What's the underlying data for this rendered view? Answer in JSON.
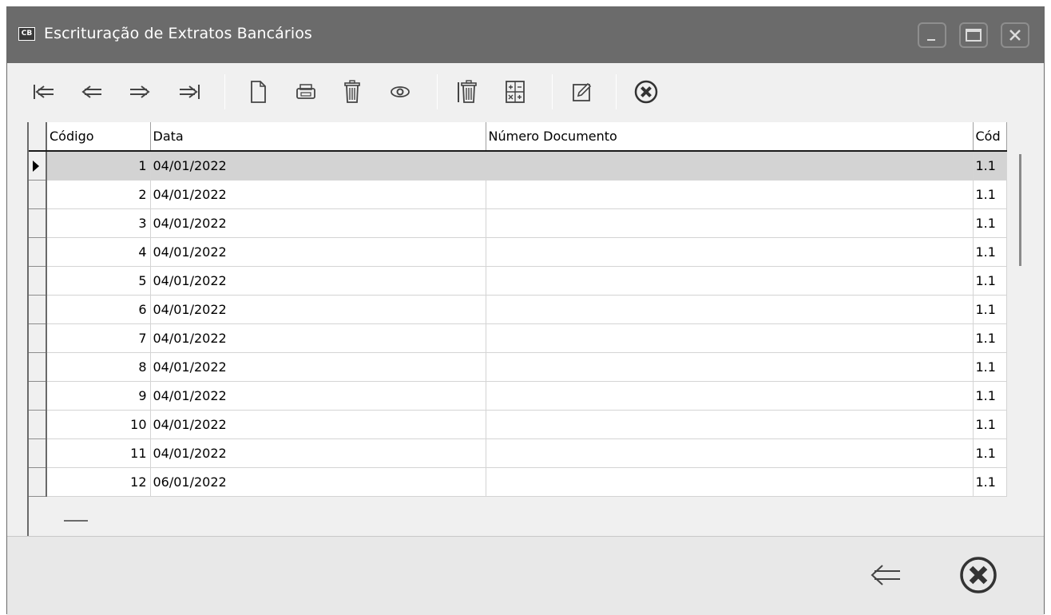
{
  "window": {
    "title": "Escrituração de Extratos Bancários",
    "app_icon_text": "CB",
    "controls": [
      "minimize-icon",
      "maximize-icon",
      "close-icon"
    ]
  },
  "toolbar": {
    "icons": [
      "first-record-icon",
      "previous-record-icon",
      "next-record-icon",
      "last-record-icon",
      "new-document-icon",
      "print-icon",
      "delete-icon",
      "view-icon",
      "delete-all-icon",
      "calculator-icon",
      "edit-icon",
      "cancel-icon"
    ]
  },
  "grid": {
    "columns": [
      "Código",
      "Data",
      "Número Documento",
      "Cód"
    ],
    "rows": [
      {
        "code": "1",
        "date": "04/01/2022",
        "doc": "",
        "cod2": "1.1"
      },
      {
        "code": "2",
        "date": "04/01/2022",
        "doc": "",
        "cod2": "1.1"
      },
      {
        "code": "3",
        "date": "04/01/2022",
        "doc": "",
        "cod2": "1.1"
      },
      {
        "code": "4",
        "date": "04/01/2022",
        "doc": "",
        "cod2": "1.1"
      },
      {
        "code": "5",
        "date": "04/01/2022",
        "doc": "",
        "cod2": "1.1"
      },
      {
        "code": "6",
        "date": "04/01/2022",
        "doc": "",
        "cod2": "1.1"
      },
      {
        "code": "7",
        "date": "04/01/2022",
        "doc": "",
        "cod2": "1.1"
      },
      {
        "code": "8",
        "date": "04/01/2022",
        "doc": "",
        "cod2": "1.1"
      },
      {
        "code": "9",
        "date": "04/01/2022",
        "doc": "",
        "cod2": "1.1"
      },
      {
        "code": "10",
        "date": "04/01/2022",
        "doc": "",
        "cod2": "1.1"
      },
      {
        "code": "11",
        "date": "04/01/2022",
        "doc": "",
        "cod2": "1.1"
      },
      {
        "code": "12",
        "date": "06/01/2022",
        "doc": "",
        "cod2": "1.1"
      }
    ]
  },
  "bottom": {
    "icons": [
      "back-arrow-icon",
      "close-circle-icon"
    ]
  },
  "colors": {
    "titlebar": "#6b6b6b",
    "selected_row": "#d3d3d3",
    "window_bg": "#f0f0f0"
  }
}
